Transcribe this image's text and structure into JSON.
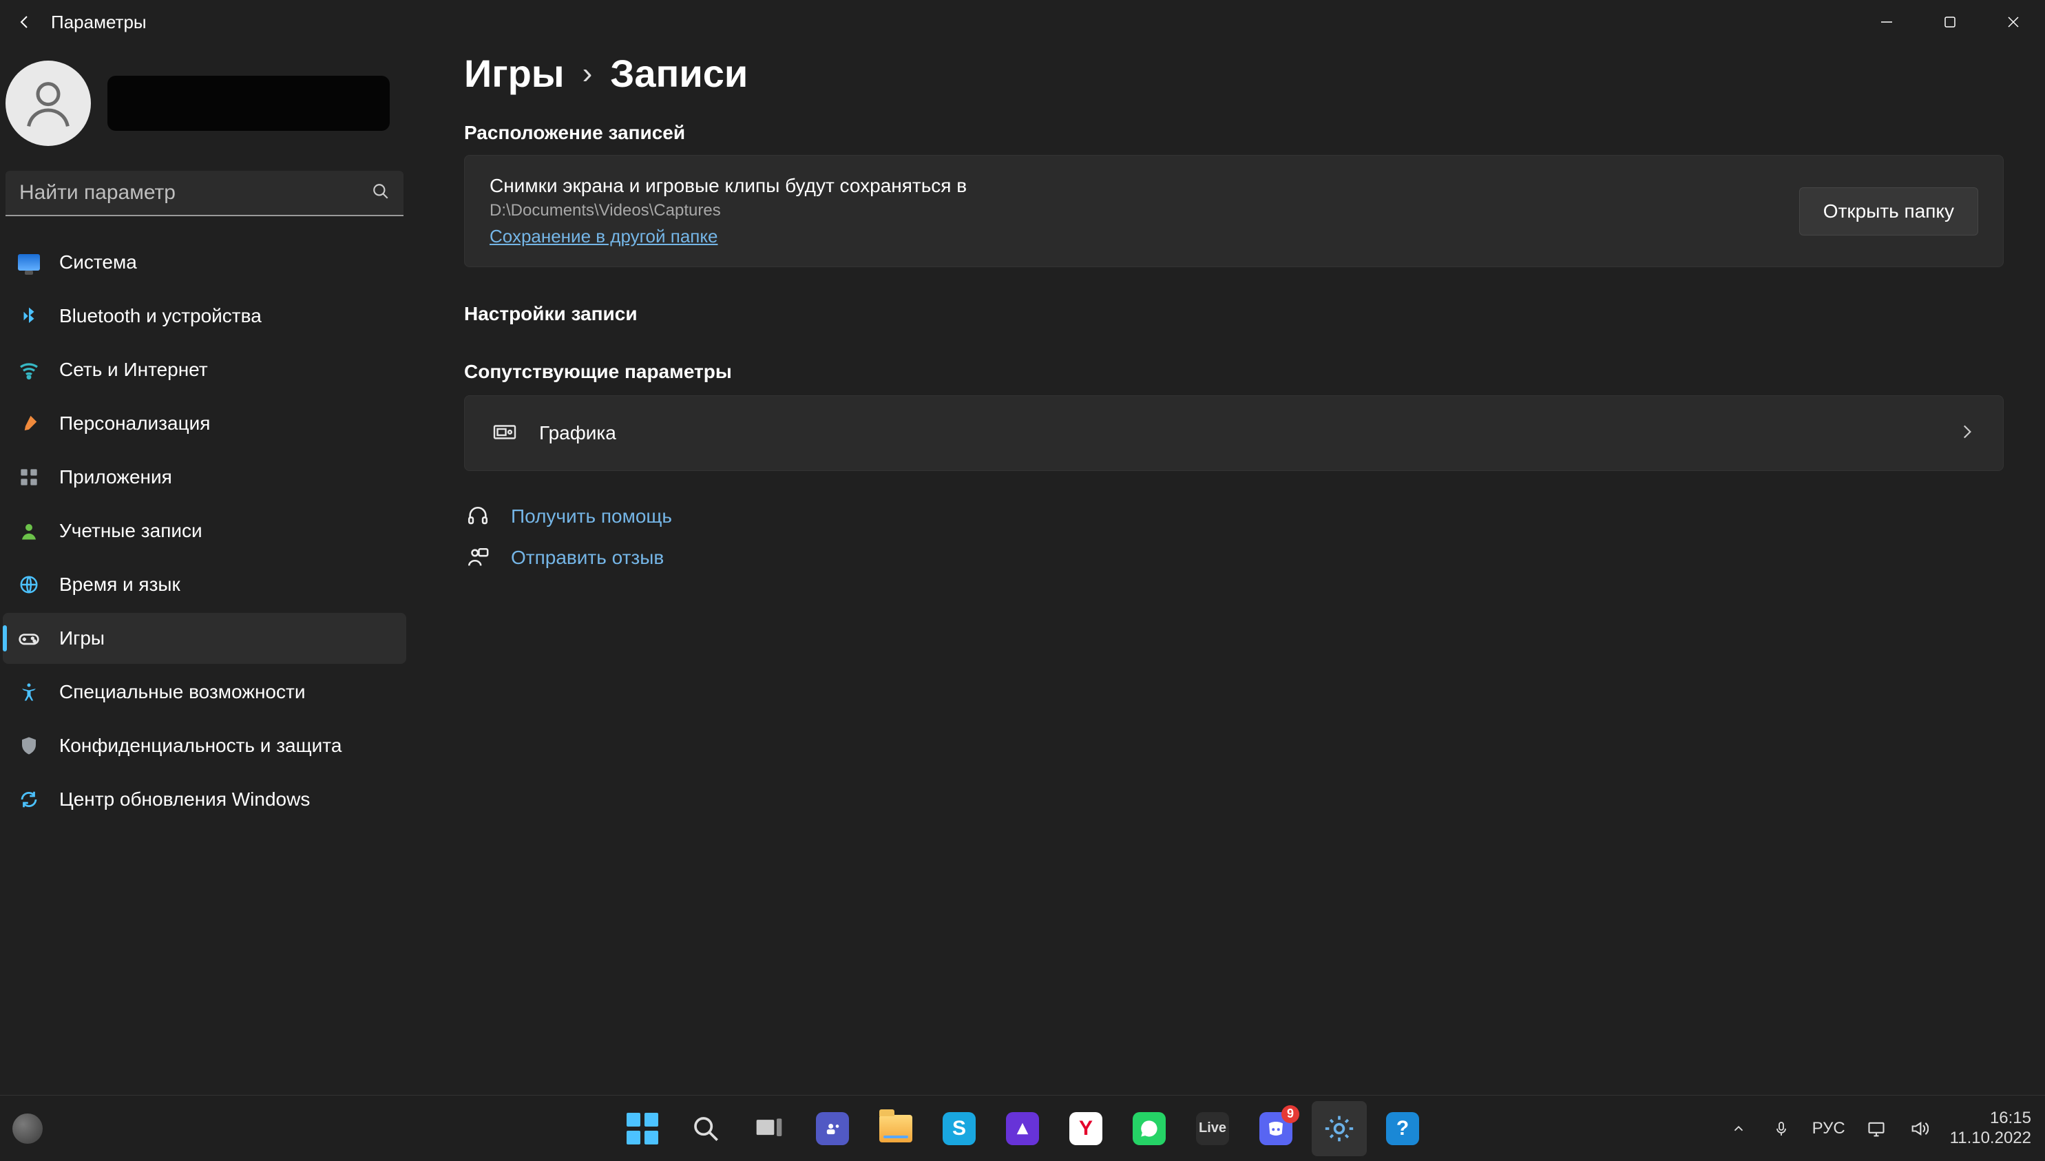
{
  "window": {
    "title": "Параметры",
    "controls": {
      "minimize": "–",
      "maximize": "▢",
      "close": "✕"
    }
  },
  "user": {
    "username": "",
    "email": ""
  },
  "search": {
    "placeholder": "Найти параметр"
  },
  "sidebar": {
    "items": [
      {
        "label": "Система",
        "icon": "monitor-icon",
        "color": ""
      },
      {
        "label": "Bluetooth и устройства",
        "icon": "bluetooth-icon",
        "color": "ic-blue"
      },
      {
        "label": "Сеть и Интернет",
        "icon": "wifi-icon",
        "color": "ic-cyan"
      },
      {
        "label": "Персонализация",
        "icon": "brush-icon",
        "color": "ic-orange"
      },
      {
        "label": "Приложения",
        "icon": "apps-icon",
        "color": "ic-gray"
      },
      {
        "label": "Учетные записи",
        "icon": "person-icon",
        "color": "ic-green"
      },
      {
        "label": "Время и язык",
        "icon": "globe-clock-icon",
        "color": "ic-blue"
      },
      {
        "label": "Игры",
        "icon": "gamepad-icon",
        "color": "ic-gray",
        "active": true
      },
      {
        "label": "Специальные возможности",
        "icon": "accessibility-icon",
        "color": "ic-blue"
      },
      {
        "label": "Конфиденциальность и защита",
        "icon": "shield-icon",
        "color": "ic-gray"
      },
      {
        "label": "Центр обновления Windows",
        "icon": "update-icon",
        "color": "ic-blue"
      }
    ]
  },
  "breadcrumb": {
    "parent": "Игры",
    "current": "Записи"
  },
  "sections": {
    "location_title": "Расположение записей",
    "recording_title": "Настройки записи",
    "related_title": "Сопутствующие параметры"
  },
  "location_card": {
    "line1": "Снимки экрана и игровые клипы будут сохраняться в",
    "path": "D:\\Documents\\Videos\\Captures",
    "change_link": "Сохранение в другой папке",
    "open_button": "Открыть папку"
  },
  "related_card": {
    "label": "Графика"
  },
  "help": {
    "get_help": "Получить помощь",
    "feedback": "Отправить отзыв"
  },
  "taskbar": {
    "apps": [
      {
        "id": "start",
        "name": "start-icon"
      },
      {
        "id": "search",
        "name": "search-icon"
      },
      {
        "id": "taskview",
        "name": "taskview-icon"
      },
      {
        "id": "teams",
        "name": "teams-icon"
      },
      {
        "id": "explorer",
        "name": "file-explorer-icon"
      },
      {
        "id": "skype",
        "name": "skype-icon"
      },
      {
        "id": "alice",
        "name": "alice-icon"
      },
      {
        "id": "yandex",
        "name": "yandex-browser-icon"
      },
      {
        "id": "whatsapp",
        "name": "whatsapp-icon"
      },
      {
        "id": "live",
        "name": "live-icon",
        "text": "Live"
      },
      {
        "id": "discord",
        "name": "discord-icon",
        "badge": "9"
      },
      {
        "id": "settings",
        "name": "settings-app-icon",
        "active": true
      },
      {
        "id": "help",
        "name": "help-icon"
      }
    ],
    "tray": {
      "lang": "РУС",
      "time": "16:15",
      "date": "11.10.2022"
    }
  }
}
